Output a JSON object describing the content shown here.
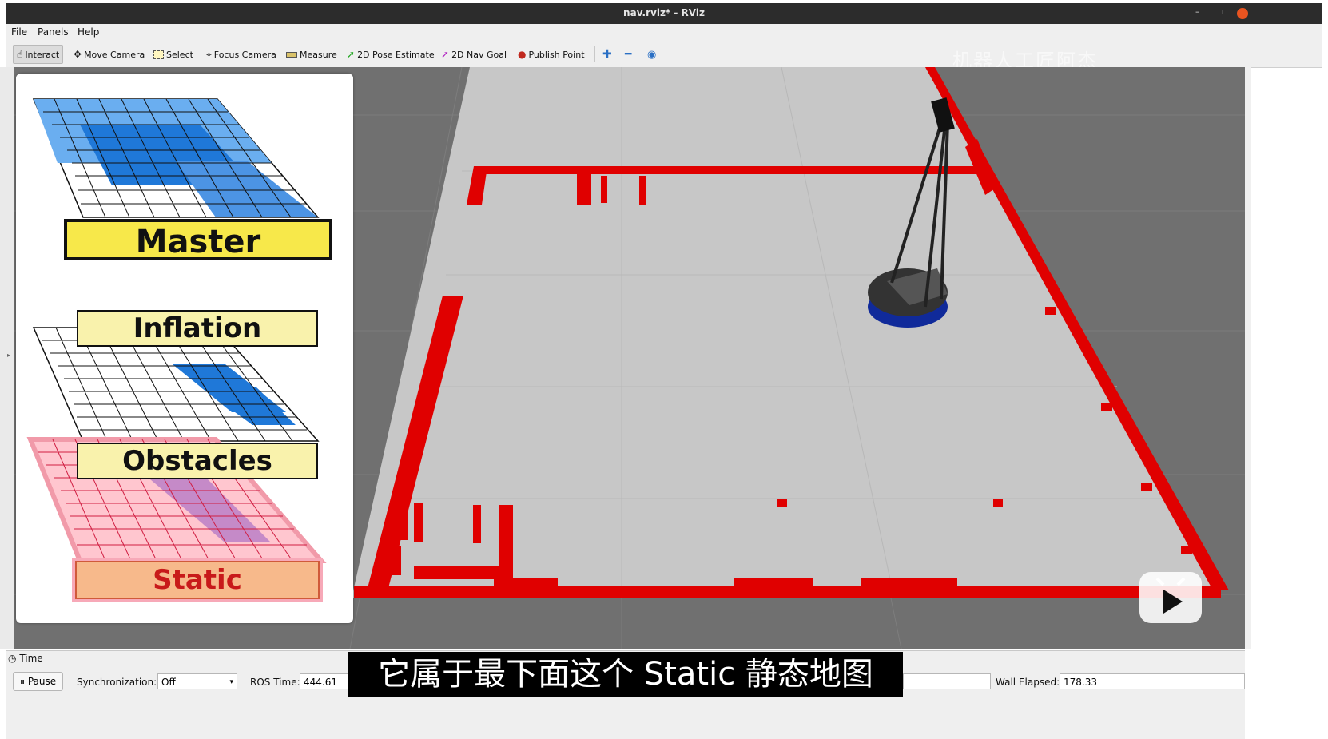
{
  "window": {
    "title": "nav.rviz* - RViz",
    "min": "–",
    "restore": "▫"
  },
  "menu": {
    "file": "File",
    "panels": "Panels",
    "help": "Help"
  },
  "toolbar": {
    "interact": "Interact",
    "move_camera": "Move Camera",
    "select": "Select",
    "focus_camera": "Focus Camera",
    "measure": "Measure",
    "pose_estimate": "2D Pose Estimate",
    "nav_goal": "2D Nav Goal",
    "publish_point": "Publish Point",
    "watermark": "机器人工匠阿杰"
  },
  "layers": {
    "master": "Master",
    "inflation": "Inflation",
    "obstacles": "Obstacles",
    "static": "Static"
  },
  "time_panel": {
    "header": "Time",
    "pause": "Pause",
    "sync_label": "Synchronization:",
    "sync_value": "Off",
    "ros_time_label": "ROS Time:",
    "ros_time_value": "444.61",
    "wall_elapsed_label": "Wall Elapsed:",
    "wall_elapsed_value": "178.33"
  },
  "subtitle": "它属于最下面这个 Static 静态地图",
  "colors": {
    "obstacle_red": "#e00000",
    "map_free": "#c7c7c7",
    "background": "#707070",
    "master_label": "#f7e84a",
    "layer_label": "#f9f2ac",
    "static_label": "#f7b98b",
    "blue_cost": "#1f78d8"
  }
}
